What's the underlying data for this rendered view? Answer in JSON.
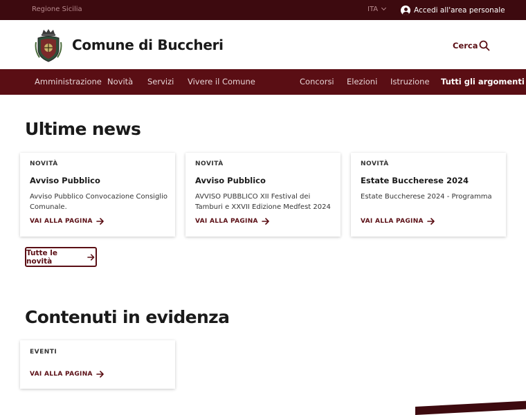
{
  "topbar": {
    "region_label": "Regione Sicilia",
    "language": "ITA",
    "login_label": "Accedi all'area personale"
  },
  "header": {
    "title": "Comune di Buccheri",
    "search_label": "Cerca"
  },
  "nav": {
    "items": [
      "Amministrazione",
      "Novità",
      "Servizi",
      "Vivere il Comune"
    ],
    "right_items": [
      "Concorsi",
      "Elezioni",
      "Istruzione",
      "Tutti gli argomenti"
    ]
  },
  "news": {
    "title": "Ultime news",
    "cards": [
      {
        "category": "NOVITÀ",
        "title": "Avviso Pubblico",
        "description": "Avviso Pubblico Convocazione Consiglio Comunale.",
        "link": "VAI ALLA PAGINA"
      },
      {
        "category": "NOVITÀ",
        "title": "Avviso Pubblico",
        "description": "AVVISO PUBBLICO XII Festival dei Tamburi e XXVII Edizione Medfest 2024",
        "link": "VAI ALLA PAGINA"
      },
      {
        "category": "NOVITÀ",
        "title": "Estate Buccherese 2024",
        "description": "Estate Buccherese 2024 - Programma",
        "link": "VAI ALLA PAGINA"
      }
    ],
    "all_button": "Tutte le novità"
  },
  "highlights": {
    "title": "Contenuti in evidenza",
    "cards": [
      {
        "category": "EVENTI",
        "link": "VAI ALLA PAGINA"
      }
    ]
  },
  "colors": {
    "topbar": "#3d0a0f",
    "primary": "#5a0e14"
  },
  "icons": {
    "user": "user-icon",
    "search": "search-icon",
    "arrow": "arrow-right-icon",
    "chevron": "chevron-down-icon"
  }
}
